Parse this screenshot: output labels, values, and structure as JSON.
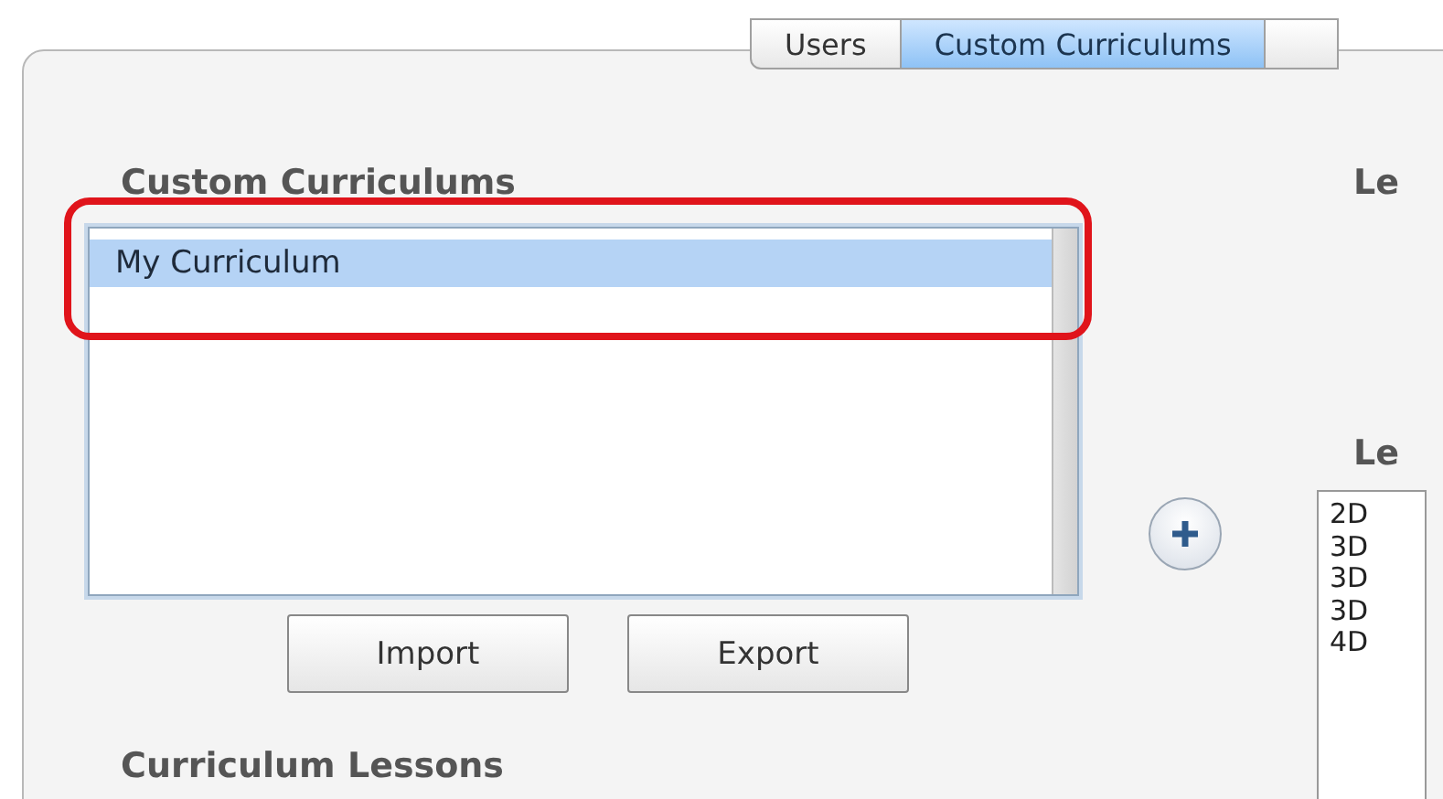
{
  "tabs": [
    {
      "label": "Users",
      "selected": false
    },
    {
      "label": "Custom Curriculums",
      "selected": true
    },
    {
      "selected": false
    }
  ],
  "custom_curriculums": {
    "heading": "Custom Curriculums",
    "items": [
      {
        "label": "My Curriculum",
        "selected": true
      }
    ],
    "highlighted": true
  },
  "buttons": [
    "Import",
    "Export"
  ],
  "curriculum_lessons": {
    "heading": "Curriculum Lessons"
  },
  "right_panel": {
    "heading_1": "Le",
    "heading_2": "Le",
    "items": [
      "2D",
      "3D",
      "3D",
      "3D",
      "4D"
    ]
  }
}
